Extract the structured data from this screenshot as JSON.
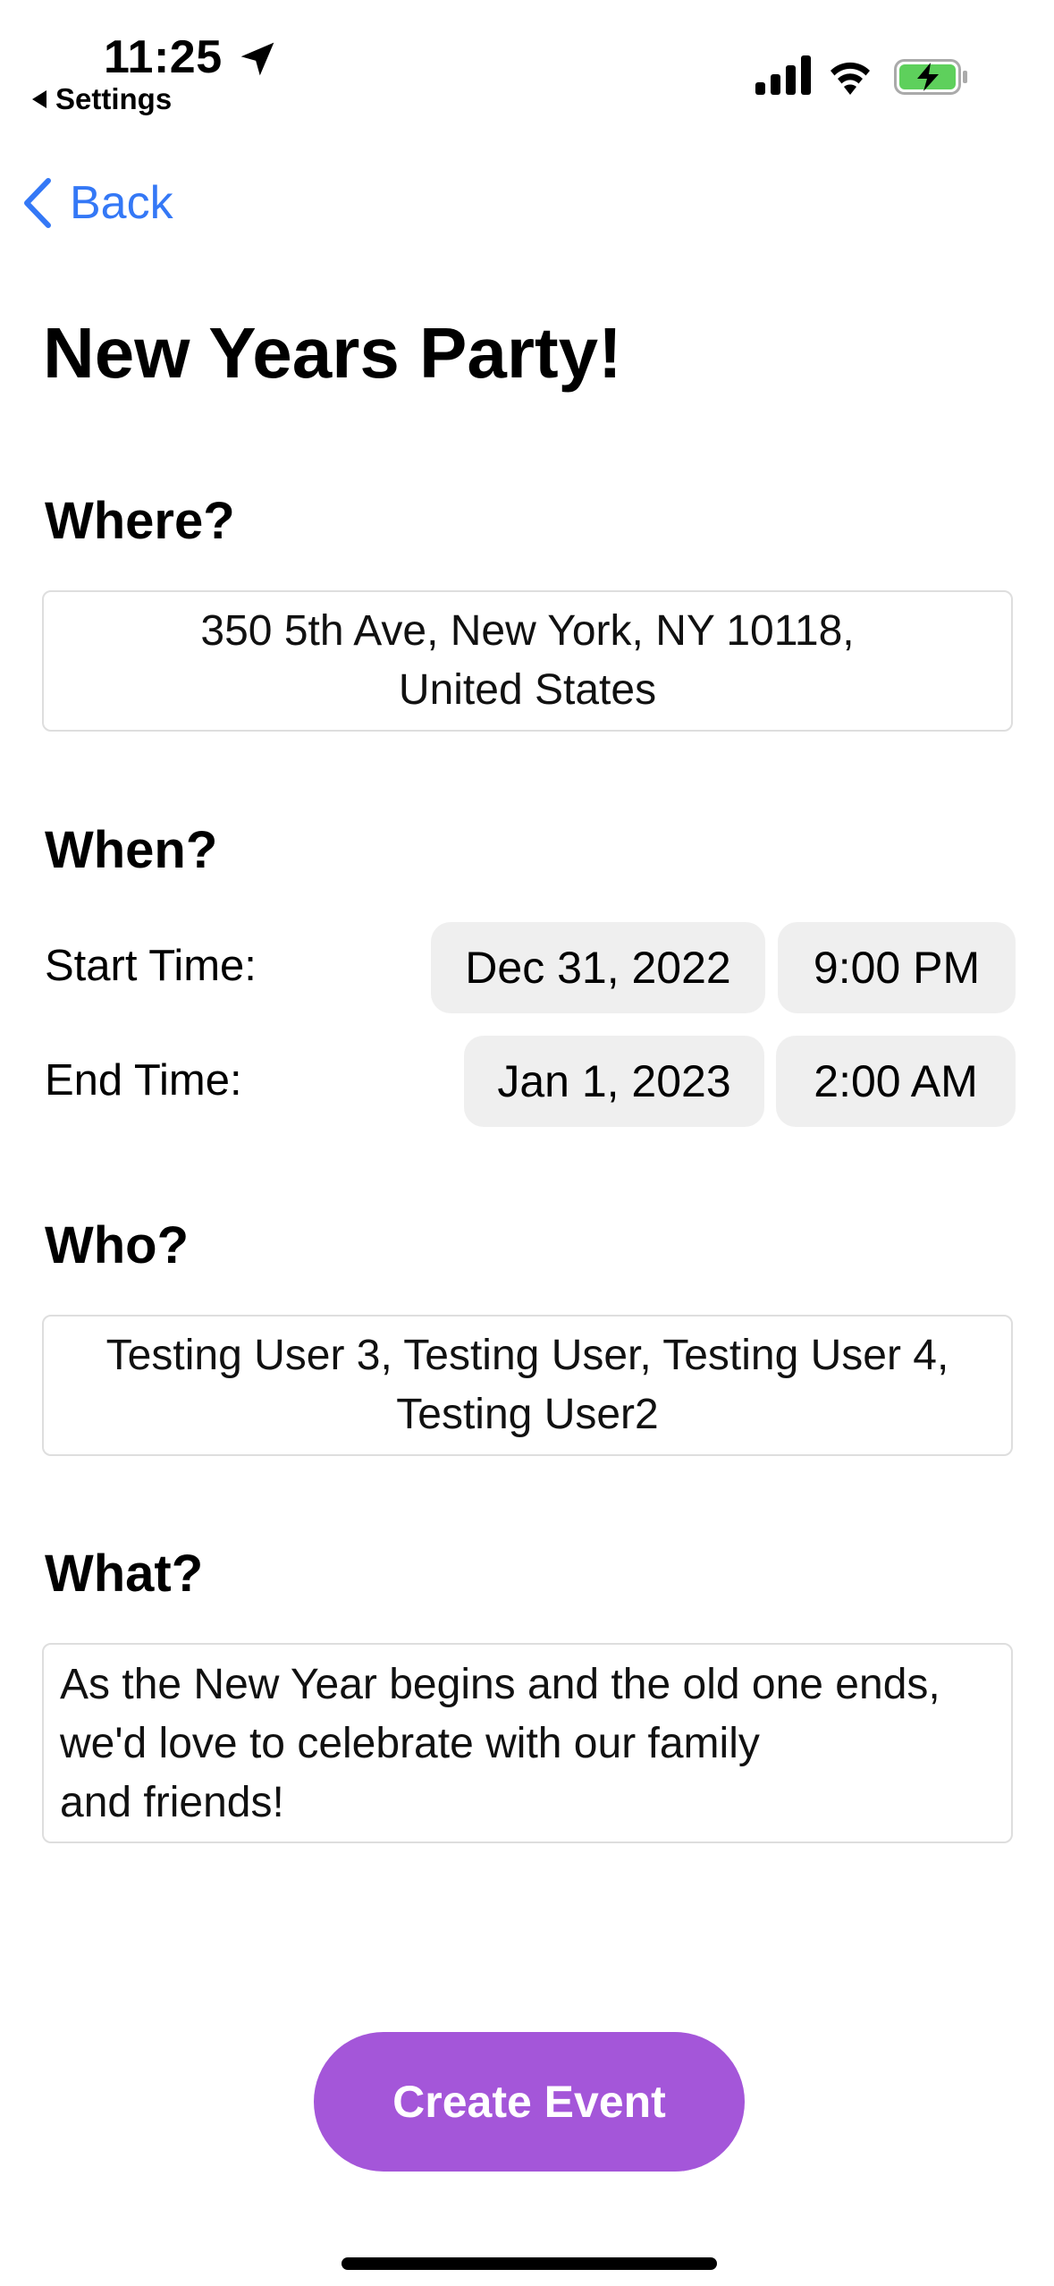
{
  "status_bar": {
    "time": "11:25",
    "back_app_label": "Settings",
    "icons": [
      "location-arrow-icon",
      "cellular-signal-icon",
      "wifi-icon",
      "battery-charging-icon"
    ],
    "battery_color": "#5ed05c"
  },
  "nav": {
    "back_label": "Back",
    "accent_color": "#3478f6"
  },
  "event": {
    "title": "New Years Party!",
    "where": {
      "heading": "Where?",
      "line1": "350 5th Ave, New York, NY  10118,",
      "line2": "United States"
    },
    "when": {
      "heading": "When?",
      "start_label": "Start Time:",
      "start_date": "Dec 31, 2022",
      "start_time": "9:00 PM",
      "end_label": "End Time:",
      "end_date": "Jan 1, 2023",
      "end_time": "2:00 AM"
    },
    "who": {
      "heading": "Who?",
      "line1": "Testing User 3, Testing User, Testing User 4,",
      "line2": "Testing User2"
    },
    "what": {
      "heading": "What?",
      "line1": "As the New Year begins and the old one ends,",
      "line2": "we'd love to celebrate with our family",
      "line3": "and friends!"
    }
  },
  "actions": {
    "create_label": "Create Event",
    "create_color": "#a456d9"
  }
}
